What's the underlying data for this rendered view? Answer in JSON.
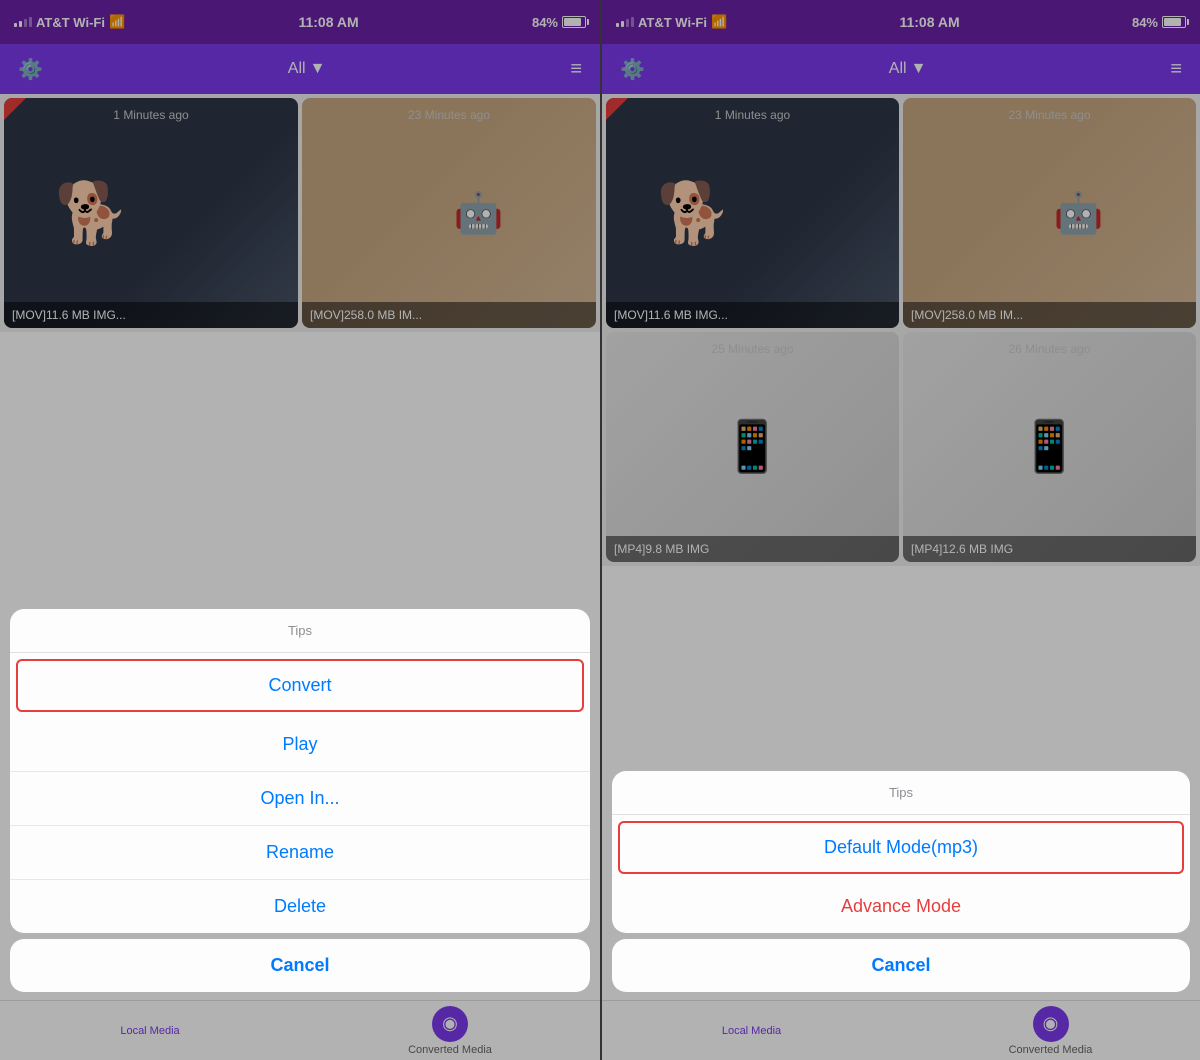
{
  "screens": [
    {
      "id": "left",
      "statusBar": {
        "carrier": "AT&T Wi-Fi",
        "time": "11:08 AM",
        "battery": "84%"
      },
      "header": {
        "allLabel": "All",
        "dropdownIcon": "▼"
      },
      "videos": [
        {
          "time": "1 Minutes ago",
          "label": "[MOV]11.6 MB IMG...",
          "hasRedCorner": true,
          "type": "dog"
        },
        {
          "time": "23 Minutes ago",
          "label": "[MOV]258.0 MB IM...",
          "hasRedCorner": false,
          "type": "room"
        }
      ],
      "modal": {
        "title": "Tips",
        "items": [
          {
            "label": "Convert",
            "highlighted": true,
            "color": "blue"
          },
          {
            "label": "Play",
            "highlighted": false,
            "color": "blue"
          },
          {
            "label": "Open In...",
            "highlighted": false,
            "color": "blue"
          },
          {
            "label": "Rename",
            "highlighted": false,
            "color": "blue"
          },
          {
            "label": "Delete",
            "highlighted": false,
            "color": "blue"
          }
        ],
        "cancel": "Cancel"
      },
      "tabs": [
        {
          "label": "Local Media",
          "active": true
        },
        {
          "label": "Converted Media",
          "active": false
        }
      ]
    },
    {
      "id": "right",
      "statusBar": {
        "carrier": "AT&T Wi-Fi",
        "time": "11:08 AM",
        "battery": "84%"
      },
      "header": {
        "allLabel": "All",
        "dropdownIcon": "▼"
      },
      "videos": [
        {
          "time": "1 Minutes ago",
          "label": "[MOV]11.6 MB IMG...",
          "hasRedCorner": true,
          "type": "dog"
        },
        {
          "time": "23 Minutes ago",
          "label": "[MOV]258.0 MB IM...",
          "hasRedCorner": false,
          "type": "room"
        },
        {
          "time": "25 Minutes ago",
          "label": "[MP4]9.8 MB IMG",
          "hasRedCorner": false,
          "type": "icons"
        },
        {
          "time": "26 Minutes ago",
          "label": "[MP4]12.6 MB IMG",
          "hasRedCorner": false,
          "type": "icons"
        }
      ],
      "modal": {
        "title": "Tips",
        "items": [
          {
            "label": "Default Mode(mp3)",
            "highlighted": true,
            "color": "blue"
          },
          {
            "label": "Advance Mode",
            "highlighted": false,
            "color": "red"
          }
        ],
        "cancel": "Cancel"
      },
      "tabs": [
        {
          "label": "Local Media",
          "active": true
        },
        {
          "label": "Converted Media",
          "active": false
        }
      ]
    }
  ]
}
